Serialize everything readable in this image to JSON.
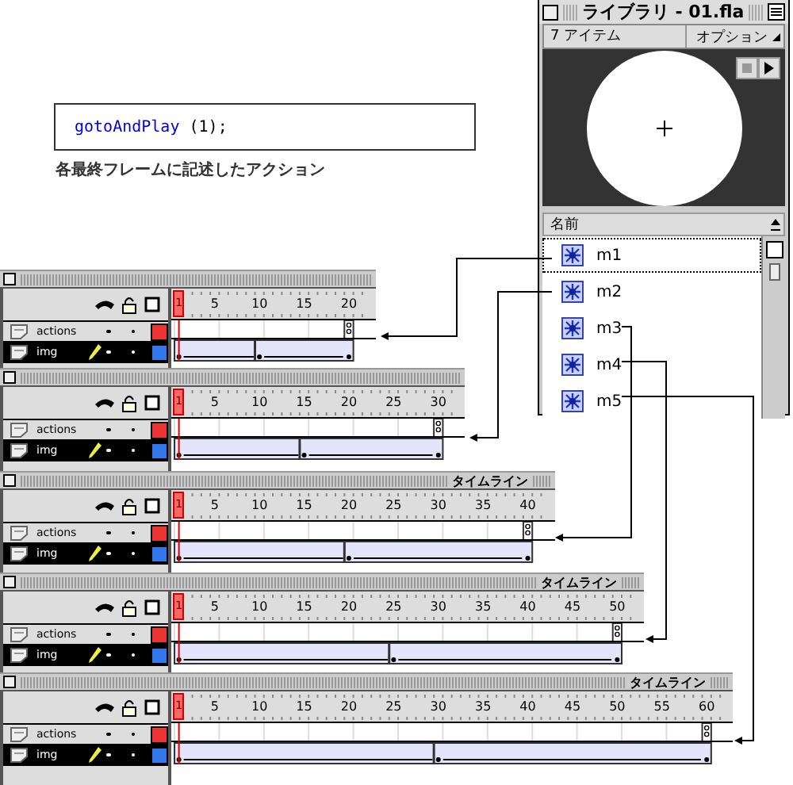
{
  "code": {
    "keyword": "gotoAndPlay",
    "rest": " (1);"
  },
  "caption": "各最終フレームに記述したアクション",
  "library": {
    "title": "ライブラリ - 01.fla",
    "item_count": "7 アイテム",
    "options": "オプション",
    "column": "名前",
    "items": [
      {
        "name": "m1",
        "selected": true
      },
      {
        "name": "m2",
        "selected": false
      },
      {
        "name": "m3",
        "selected": false
      },
      {
        "name": "m4",
        "selected": false
      },
      {
        "name": "m5",
        "selected": false
      }
    ]
  },
  "timelines": [
    {
      "current_frame": "1",
      "ticks": [
        "5",
        "10",
        "15",
        "20"
      ],
      "layers": [
        {
          "name": "actions",
          "color": "#ee3333",
          "selected": false
        },
        {
          "name": "img",
          "color": "#3377ee",
          "selected": true
        }
      ]
    },
    {
      "current_frame": "1",
      "ticks": [
        "5",
        "10",
        "15",
        "20",
        "25",
        "30"
      ],
      "layers": [
        {
          "name": "actions",
          "color": "#ee3333",
          "selected": false
        },
        {
          "name": "img",
          "color": "#3377ee",
          "selected": true
        }
      ]
    },
    {
      "title": "タイムライン",
      "current_frame": "1",
      "ticks": [
        "5",
        "10",
        "15",
        "20",
        "25",
        "30",
        "35",
        "40"
      ],
      "layers": [
        {
          "name": "actions",
          "color": "#ee3333",
          "selected": false
        },
        {
          "name": "img",
          "color": "#3377ee",
          "selected": true
        }
      ]
    },
    {
      "title": "タイムライン",
      "current_frame": "1",
      "ticks": [
        "5",
        "10",
        "15",
        "20",
        "25",
        "30",
        "35",
        "40",
        "45",
        "50"
      ],
      "layers": [
        {
          "name": "actions",
          "color": "#ee3333",
          "selected": false
        },
        {
          "name": "img",
          "color": "#3377ee",
          "selected": true
        }
      ]
    },
    {
      "title": "タイムライン",
      "current_frame": "1",
      "ticks": [
        "5",
        "10",
        "15",
        "20",
        "25",
        "30",
        "35",
        "40",
        "45",
        "50",
        "55",
        "60"
      ],
      "layers": [
        {
          "name": "actions",
          "color": "#ee3333",
          "selected": false
        },
        {
          "name": "img",
          "color": "#3377ee",
          "selected": true
        }
      ]
    }
  ]
}
